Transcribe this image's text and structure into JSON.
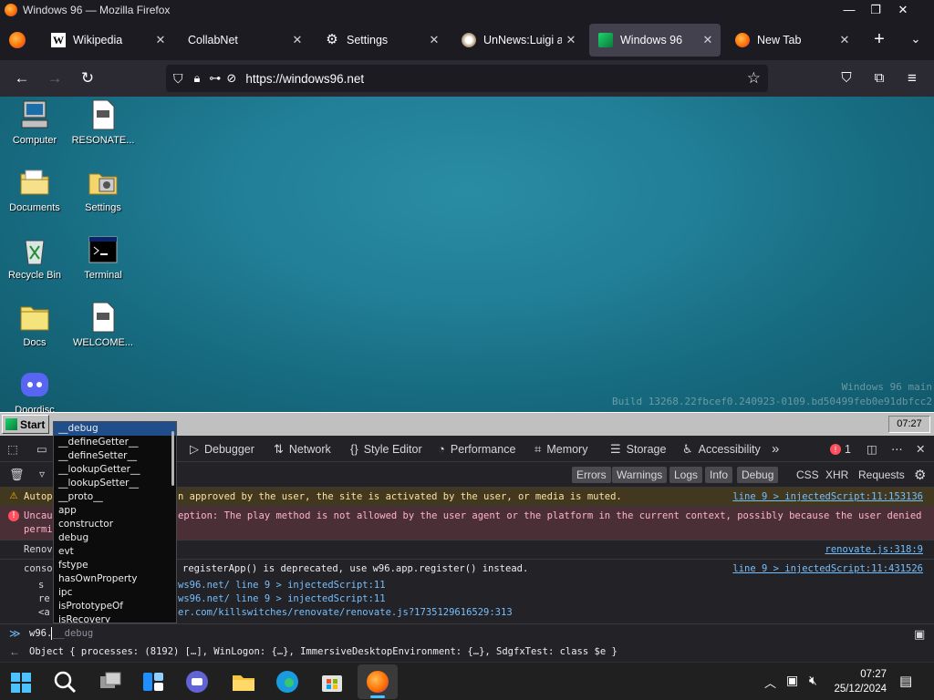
{
  "window": {
    "title": "Windows 96 — Mozilla Firefox"
  },
  "tabs": [
    {
      "label": "Wikipedia",
      "active": false
    },
    {
      "label": "CollabNet",
      "active": false
    },
    {
      "label": "Settings",
      "active": false
    },
    {
      "label": "UnNews:Luigi ap",
      "active": false
    },
    {
      "label": "Windows 96",
      "active": true
    },
    {
      "label": "New Tab",
      "active": false
    }
  ],
  "urlbar": {
    "url": "https://windows96.net"
  },
  "desktop": {
    "icons": [
      {
        "name": "Computer",
        "icon": "computer-icon"
      },
      {
        "name": "RESONATE...",
        "icon": "document-icon"
      },
      {
        "name": "Documents",
        "icon": "folder-icon"
      },
      {
        "name": "Settings",
        "icon": "settings-icon"
      },
      {
        "name": "Recycle Bin",
        "icon": "recycle-bin-icon"
      },
      {
        "name": "Terminal",
        "icon": "terminal-icon"
      },
      {
        "name": "Docs",
        "icon": "folder-icon"
      },
      {
        "name": "WELCOME...",
        "icon": "document-icon"
      },
      {
        "name": "Doordisc",
        "icon": "discord-icon"
      }
    ],
    "watermark_line1": "Windows 96 main",
    "watermark_line2": "Build 13268.22fbcef0.240923-0109.bd50499feb0e91dbfcc2"
  },
  "w96taskbar": {
    "start_label": "Start",
    "clock": "07:27"
  },
  "devtools": {
    "tabs": [
      "Debugger",
      "Network",
      "Style Editor",
      "Performance",
      "Memory",
      "Storage",
      "Accessibility"
    ],
    "error_count": "1",
    "filters": [
      "Errors",
      "Warnings",
      "Logs",
      "Info",
      "Debug"
    ],
    "filters_right": [
      "CSS",
      "XHR",
      "Requests"
    ],
    "messages": {
      "m1_prefix": "Autop",
      "m1_text": "n approved by the user, the site is activated by the user, or media is muted.",
      "m1_src": "line 9 > injectedScript:11:153136",
      "m2_prefix": "Uncau",
      "m2_text": "eption: The play method is not allowed by the user agent or the platform in the current context, possibly because the user denied",
      "m2_prefix2": "permi",
      "m3_prefix": "Renov",
      "m3_src": "renovate.js:318:9",
      "m4_prefix": "conso",
      "m4_text": "registerApp() is deprecated, use w96.app.register() instead.",
      "m4_src": "line 9 > injectedScript:11:431526",
      "m4_s": "s",
      "m4_s_text": "ws96.net/ line 9 > injectedScript:11",
      "m4_r": "re",
      "m4_r_text": "ws96.net/ line 9 > injectedScript:11",
      "m4_a": "<a",
      "m4_a_text": "er.com/killswitches/renovate/renovate.js?1735129616529:313"
    },
    "input_text": "w96.",
    "input_suggestion": "__debug",
    "result": "Object { processes: (8192) […], WinLogon: {…}, ImmersiveDesktopEnvironment: {…}, SdgfxTest: class $e }",
    "autocomplete": [
      "__debug",
      "__defineGetter__",
      "__defineSetter__",
      "__lookupGetter__",
      "__lookupSetter__",
      "__proto__",
      "app",
      "constructor",
      "debug",
      "evt",
      "fstype",
      "hasOwnProperty",
      "ipc",
      "isPrototypeOf",
      "isRecovery"
    ]
  },
  "wintaskbar": {
    "time": "07:27",
    "date": "25/12/2024"
  }
}
